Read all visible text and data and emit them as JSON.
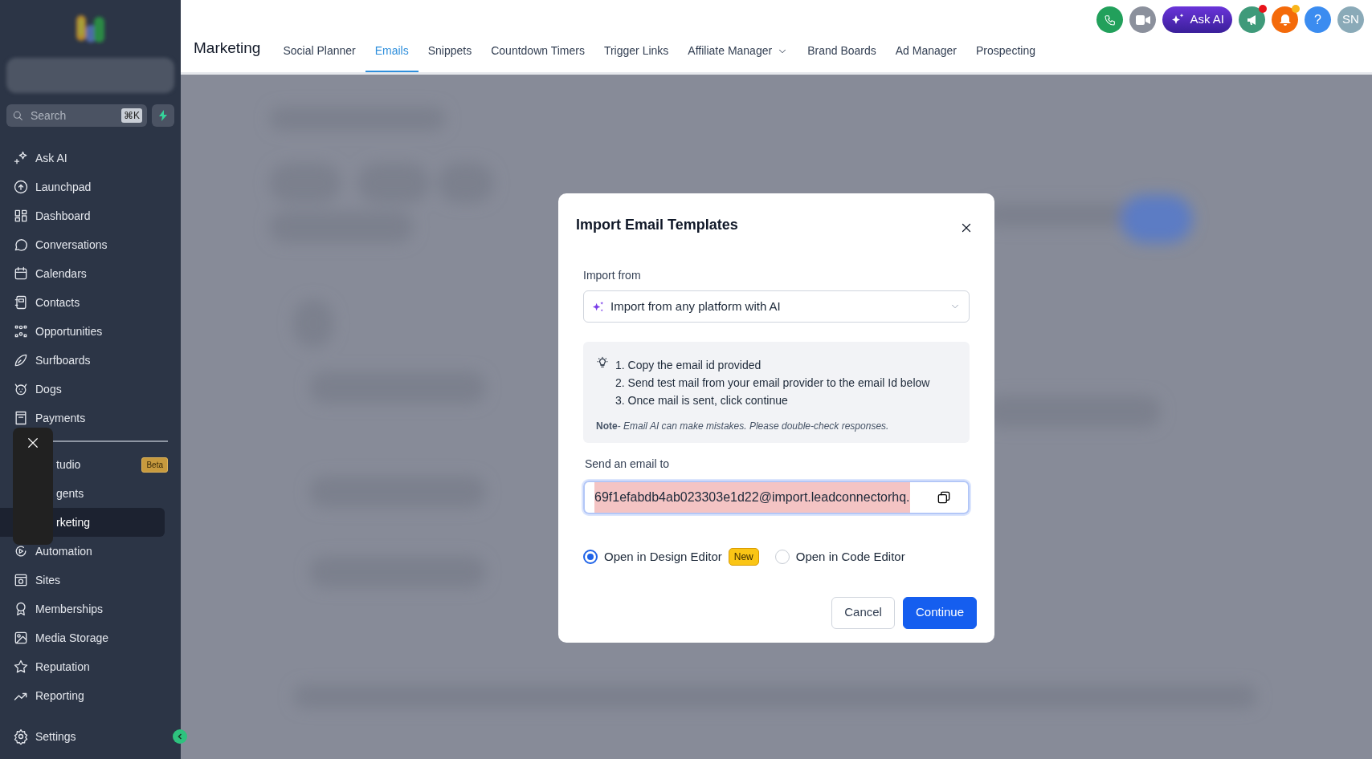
{
  "sidebar": {
    "search": {
      "placeholder": "Search",
      "shortcut": "⌘K"
    },
    "items": [
      {
        "label": "Ask AI",
        "selected": false
      },
      {
        "label": "Launchpad",
        "selected": false
      },
      {
        "label": "Dashboard",
        "selected": false
      },
      {
        "label": "Conversations",
        "selected": false
      },
      {
        "label": "Calendars",
        "selected": false
      },
      {
        "label": "Contacts",
        "selected": false
      },
      {
        "label": "Opportunities",
        "selected": false
      },
      {
        "label": "Surfboards",
        "selected": false
      },
      {
        "label": "Dogs",
        "selected": false
      },
      {
        "label": "Payments",
        "selected": false
      },
      {
        "kind": "divider"
      },
      {
        "label": "tudio",
        "badge": "Beta",
        "selected": false
      },
      {
        "label": "gents",
        "selected": false
      },
      {
        "label": "rketing",
        "selected": true
      },
      {
        "label": "Automation",
        "selected": false
      },
      {
        "label": "Sites",
        "selected": false
      },
      {
        "label": "Memberships",
        "selected": false
      },
      {
        "label": "Media Storage",
        "selected": false
      },
      {
        "label": "Reputation",
        "selected": false
      },
      {
        "label": "Reporting",
        "selected": false
      }
    ],
    "settings": {
      "label": "Settings"
    }
  },
  "header": {
    "title": "Marketing",
    "tabs": [
      {
        "label": "Social Planner",
        "selected": false
      },
      {
        "label": "Emails",
        "selected": true
      },
      {
        "label": "Snippets",
        "selected": false
      },
      {
        "label": "Countdown Timers",
        "selected": false
      },
      {
        "label": "Trigger Links",
        "selected": false
      },
      {
        "label": "Affiliate Manager",
        "selected": false,
        "dropdown": true
      },
      {
        "label": "Brand Boards",
        "selected": false
      },
      {
        "label": "Ad Manager",
        "selected": false
      },
      {
        "label": "Prospecting",
        "selected": false
      }
    ],
    "ask_ai": "Ask AI",
    "help": "?",
    "avatar": "SN"
  },
  "modal": {
    "title": "Import Email Templates",
    "import_label": "Import from",
    "import_value": "Import from any platform with AI",
    "steps": [
      "1. Copy the email id provided",
      "2. Send test mail from your email provider to the email Id below",
      "3. Once mail is sent, click continue"
    ],
    "note": "**Note**- *Email AI can make mistakes. Please double-check responses.*",
    "email_label": "Send an email to",
    "email": {
      "value": "69f1efabdb4ab023303e1d22@import.leadconnectorhq.",
      "selected": true
    },
    "editors": [
      {
        "label": "Open in Design Editor",
        "badge": "New",
        "selected": true
      },
      {
        "label": "Open in Code Editor",
        "selected": false
      }
    ],
    "buttons": [
      {
        "label": "Cancel",
        "kind": "secondary"
      },
      {
        "label": "Continue",
        "kind": "primary"
      }
    ]
  }
}
